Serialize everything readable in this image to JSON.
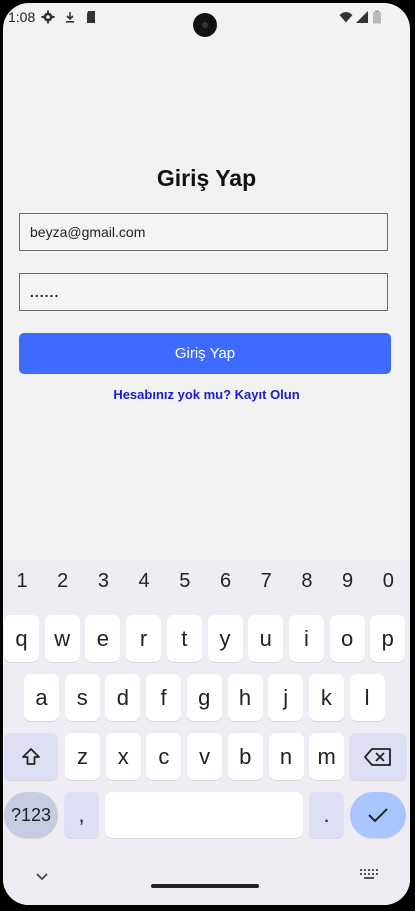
{
  "status_bar": {
    "time": "1:08"
  },
  "login": {
    "title": "Giriş Yap",
    "email_value": "beyza@gmail.com",
    "password_value": "......",
    "button_label": "Giriş Yap",
    "register_link": "Hesabınız yok mu? Kayıt Olun"
  },
  "keyboard": {
    "numbers": [
      "1",
      "2",
      "3",
      "4",
      "5",
      "6",
      "7",
      "8",
      "9",
      "0"
    ],
    "row1": [
      "q",
      "w",
      "e",
      "r",
      "t",
      "y",
      "u",
      "i",
      "o",
      "p"
    ],
    "row2": [
      "a",
      "s",
      "d",
      "f",
      "g",
      "h",
      "j",
      "k",
      "l"
    ],
    "row3": [
      "z",
      "x",
      "c",
      "v",
      "b",
      "n",
      "m"
    ],
    "symbols_label": "?123",
    "comma": ",",
    "period": "."
  },
  "colors": {
    "accent": "#3d6bff",
    "link": "#1a19d4",
    "keyboard_bg": "#efedf3",
    "enter_key": "#a8c5ff"
  },
  "icons": [
    "settings-icon",
    "download-icon",
    "sd-card-icon",
    "wifi-icon",
    "signal-icon",
    "battery-icon",
    "shift-icon",
    "backspace-icon",
    "enter-check-icon",
    "keyboard-hide-icon",
    "keyboard-switch-icon"
  ]
}
